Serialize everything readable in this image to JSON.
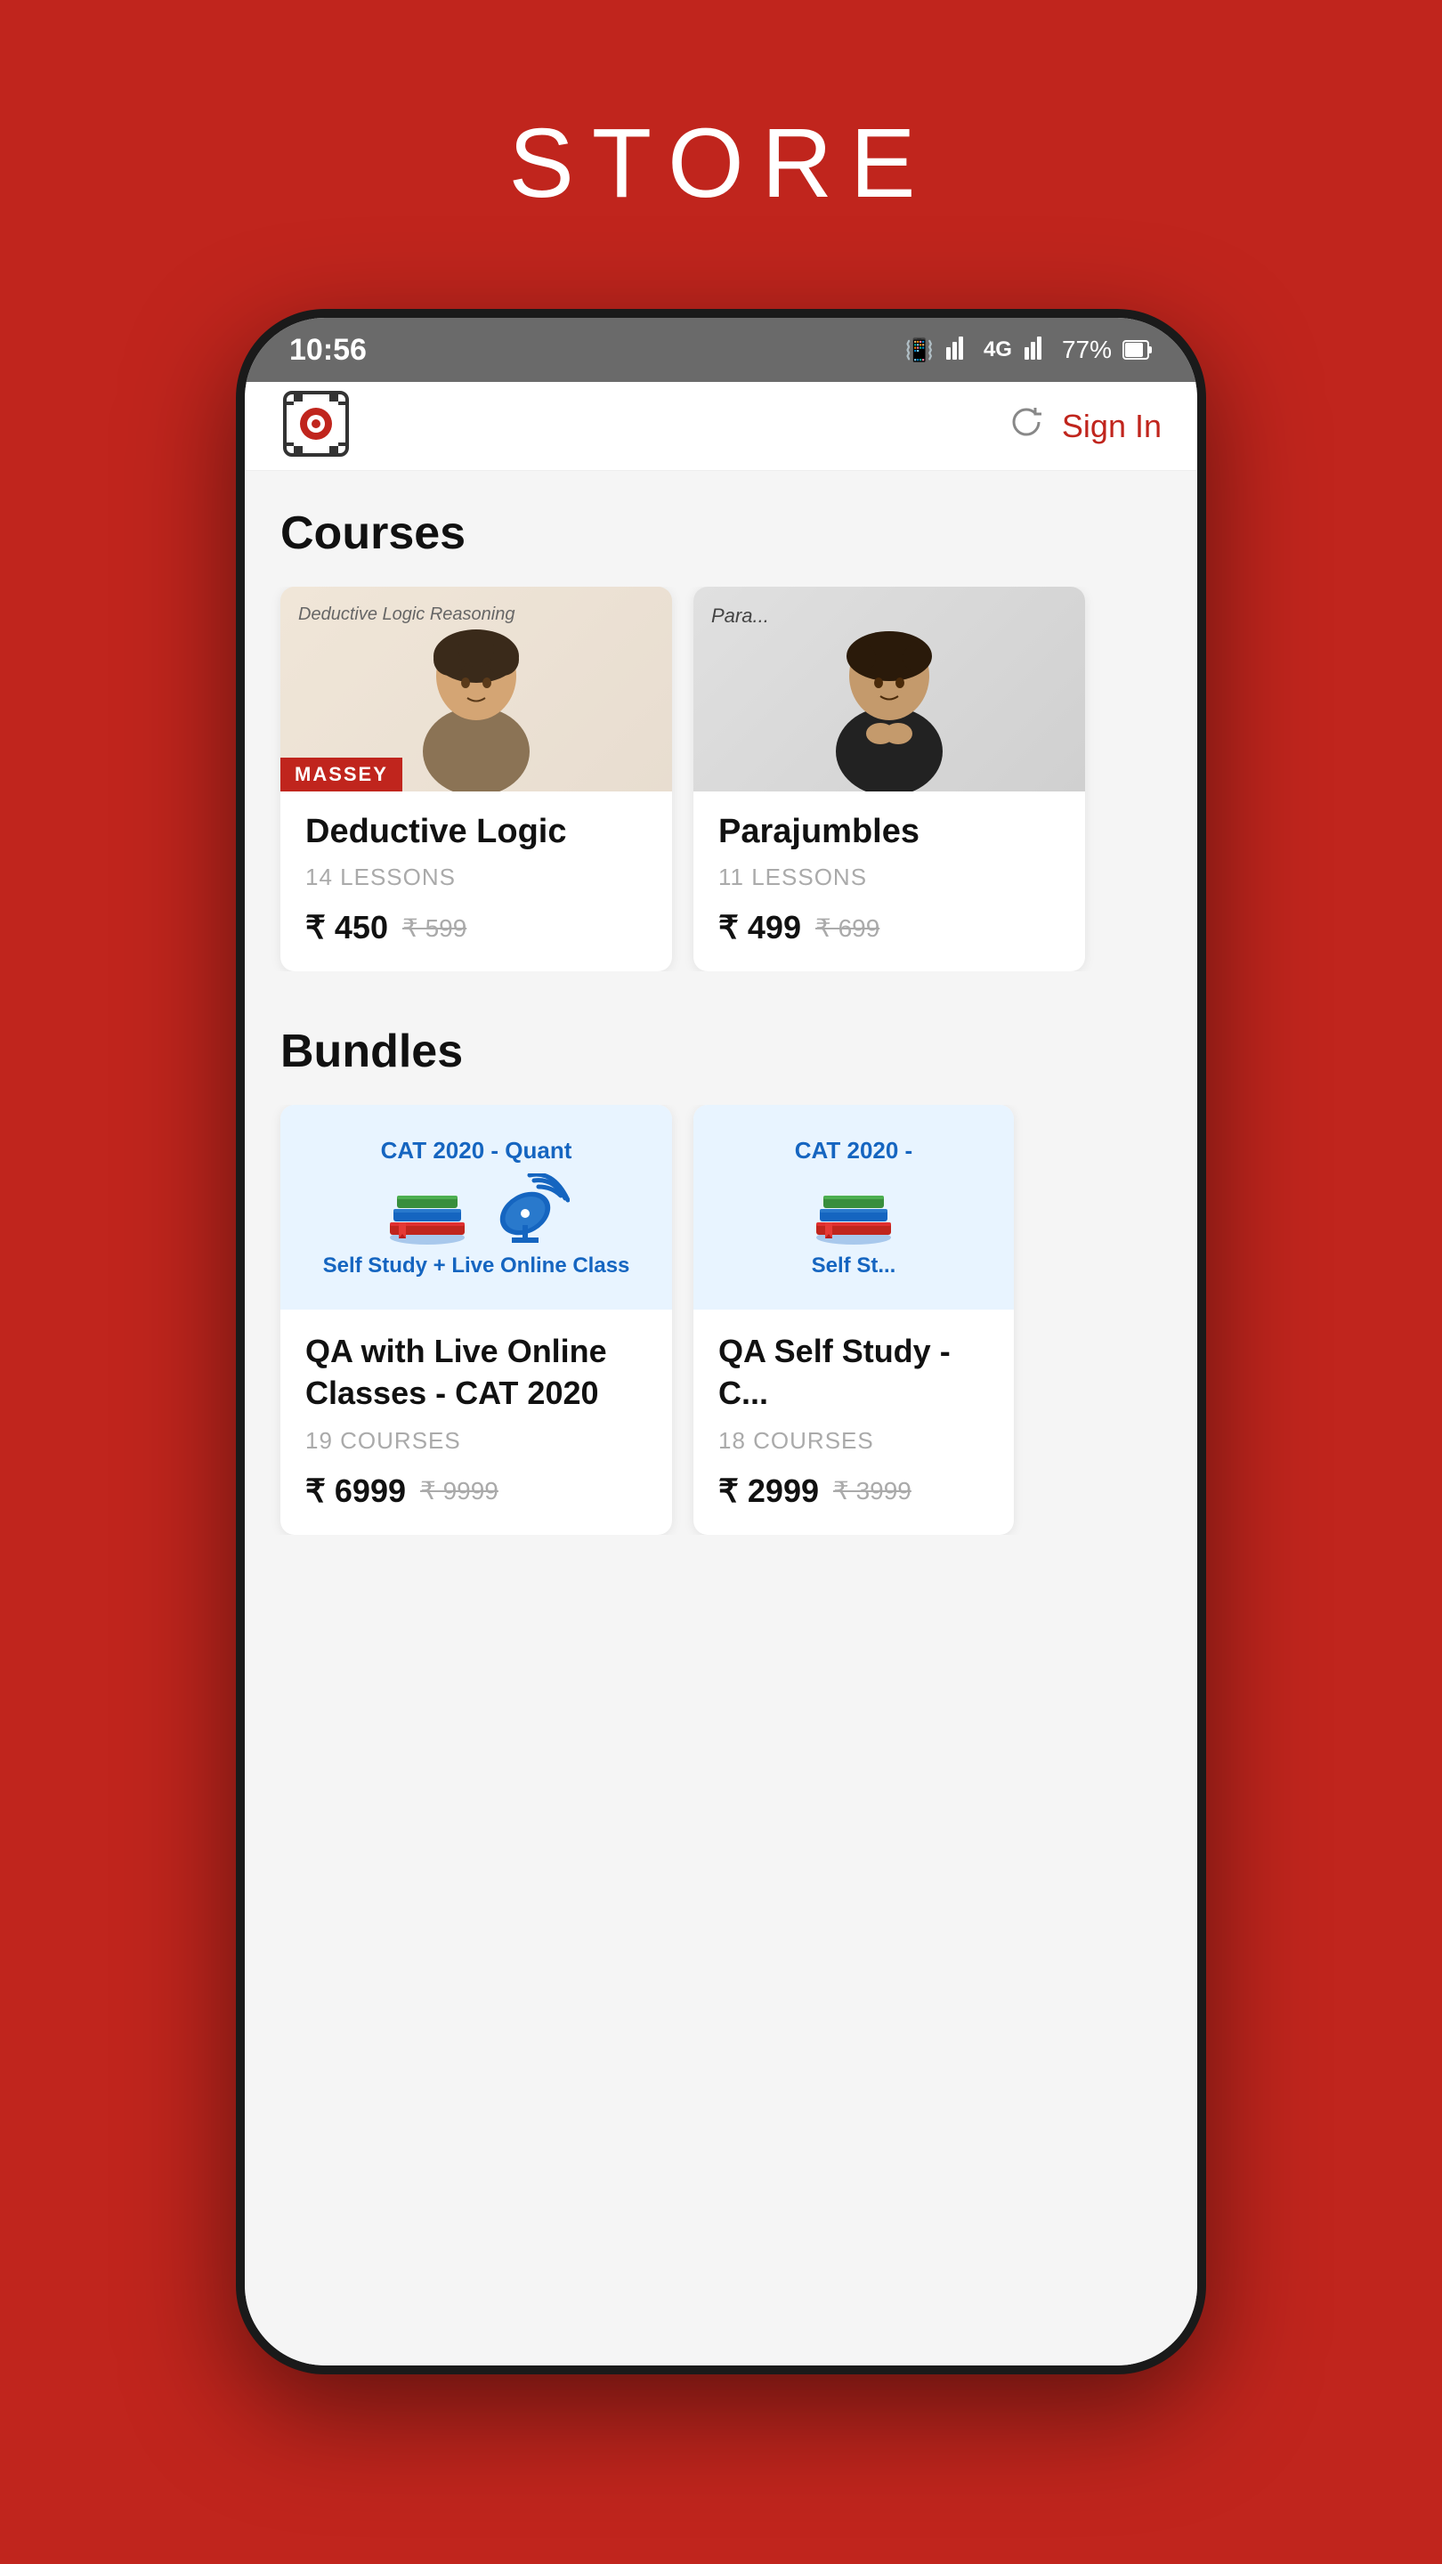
{
  "page": {
    "title": "STORE",
    "background_color": "#c0251d"
  },
  "status_bar": {
    "time": "10:56",
    "signal_icon": "📶",
    "battery": "77%",
    "network": "4G"
  },
  "header": {
    "logo_alt": "App Logo",
    "sign_in_label": "Sign In",
    "refresh_label": "refresh"
  },
  "courses_section": {
    "title": "Courses",
    "items": [
      {
        "id": "deductive-logic",
        "name": "Deductive Logic",
        "lessons": "14 LESSONS",
        "price_current": "₹ 450",
        "price_original": "₹ 599",
        "instructor": "MASSEY",
        "whiteboard_text": "Deductive Logic Reasoning"
      },
      {
        "id": "parajumbles",
        "name": "Parajumbles",
        "lessons": "11 LESSONS",
        "price_current": "₹ 499",
        "price_original": "₹ 699",
        "instructor": "",
        "whiteboard_text": "Para..."
      }
    ]
  },
  "bundles_section": {
    "title": "Bundles",
    "items": [
      {
        "id": "qa-live",
        "img_title_line1": "CAT 2020 - Quant",
        "img_subtitle": "Self Study + Live Online Class",
        "name": "QA with Live Online Classes - CAT 2020",
        "courses": "19 COURSES",
        "price_current": "₹ 6999",
        "price_original": "₹ 9999"
      },
      {
        "id": "qa-self",
        "img_title_line1": "CAT 2020 -",
        "img_subtitle": "Self St...",
        "name": "QA Self Study - C...",
        "courses": "18 COURSES",
        "price_current": "₹ 2999",
        "price_original": "₹ 3999"
      }
    ]
  }
}
